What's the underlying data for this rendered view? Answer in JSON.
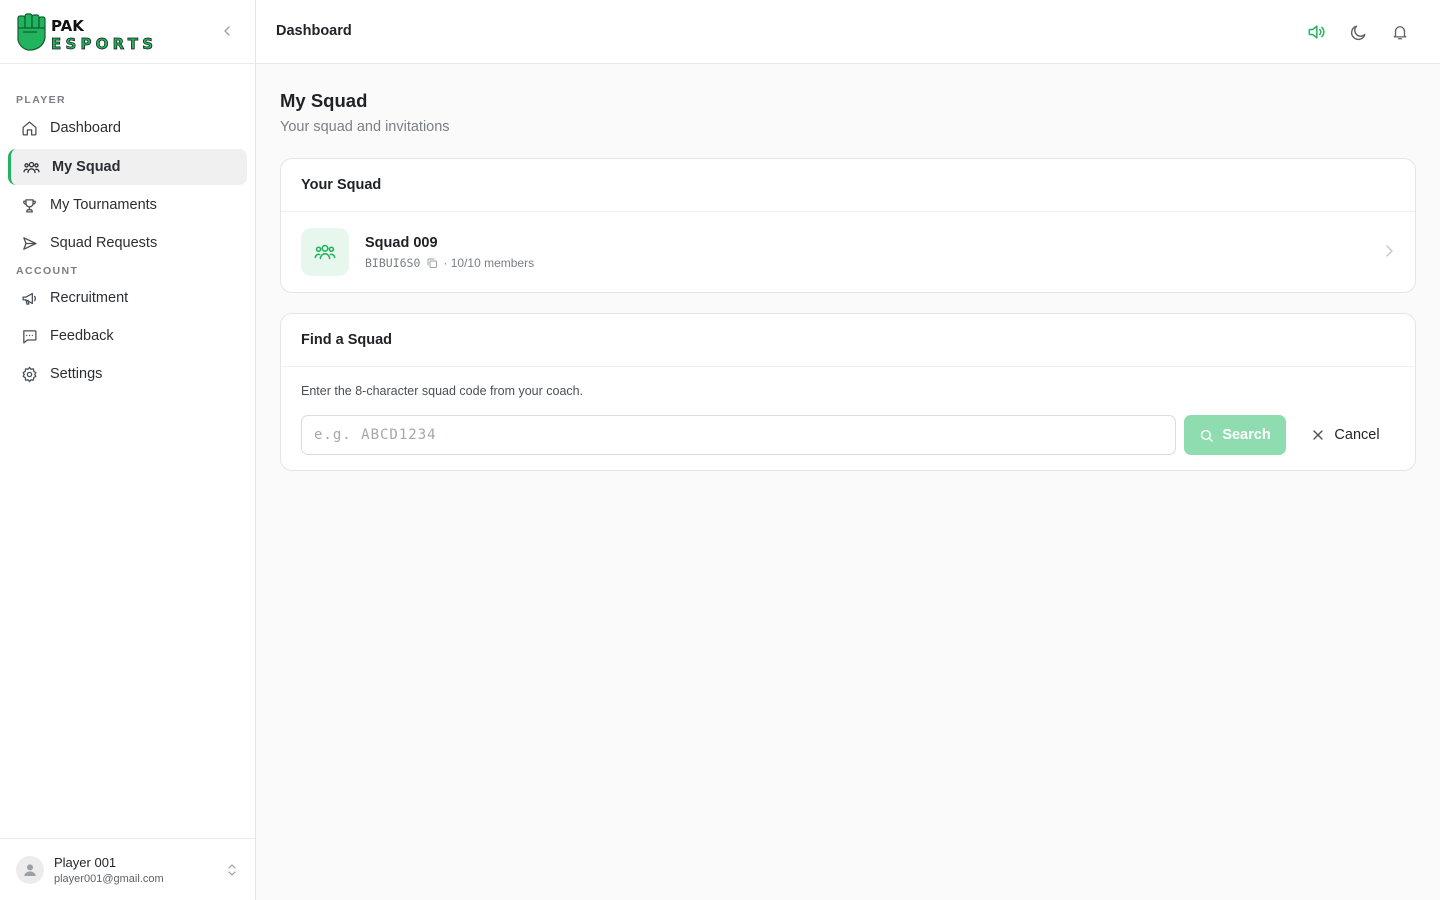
{
  "brand": {
    "line1": "PAK",
    "line2": "ESPORTS",
    "accent": "#22b35e"
  },
  "sidebar": {
    "sections": [
      {
        "label": "PLAYER"
      },
      {
        "label": "ACCOUNT"
      }
    ],
    "items": [
      {
        "label": "Dashboard",
        "icon": "home-icon"
      },
      {
        "label": "My Squad",
        "icon": "users-icon",
        "active": true
      },
      {
        "label": "My Tournaments",
        "icon": "trophy-icon"
      },
      {
        "label": "Squad Requests",
        "icon": "send-icon"
      },
      {
        "label": "Recruitment",
        "icon": "megaphone-icon"
      },
      {
        "label": "Feedback",
        "icon": "message-icon"
      },
      {
        "label": "Settings",
        "icon": "gear-icon"
      }
    ],
    "user": {
      "name": "Player 001",
      "email": "player001@gmail.com"
    }
  },
  "header": {
    "breadcrumb": "Dashboard"
  },
  "page": {
    "title": "My Squad",
    "subtitle": "Your squad and invitations"
  },
  "your_squad": {
    "heading": "Your Squad",
    "name": "Squad 009",
    "code": "BIBUI6S0",
    "members": "· 10/10 members"
  },
  "find_squad": {
    "heading": "Find a Squad",
    "help": "Enter the 8-character squad code from your coach.",
    "placeholder": "e.g. ABCD1234",
    "value": "",
    "search_label": "Search",
    "cancel_label": "Cancel"
  }
}
